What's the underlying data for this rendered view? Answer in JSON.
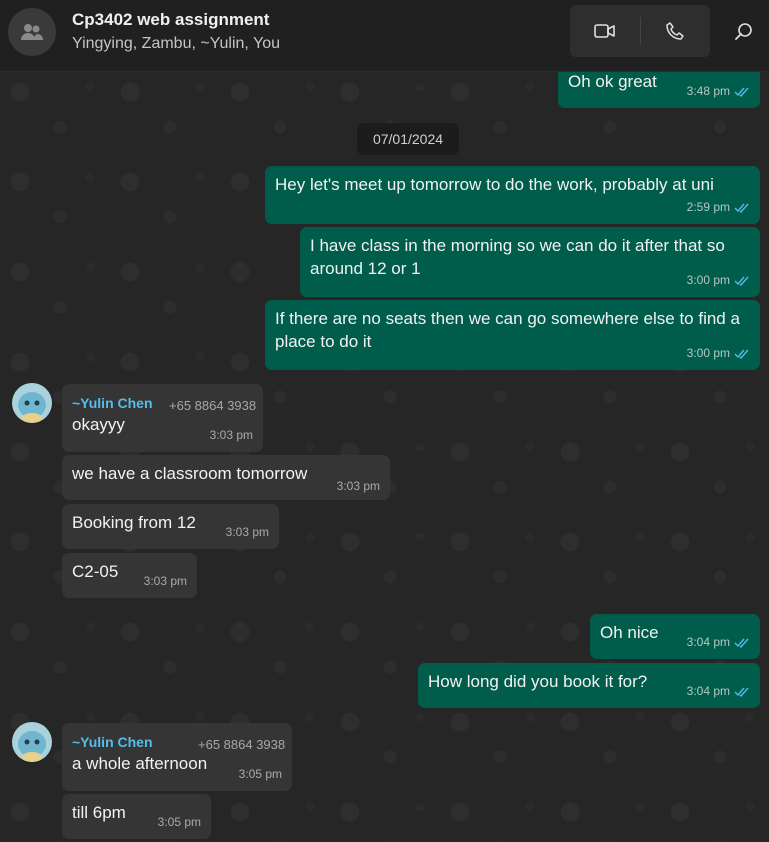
{
  "header": {
    "title": "Cp3402 web assignment",
    "members": "Yingying, Zambu, ~Yulin, You",
    "icons": {
      "avatar": "group-icon",
      "video": "video-icon",
      "call": "phone-icon",
      "search": "search-icon"
    }
  },
  "date_chip": "07/01/2024",
  "messages": [
    {
      "dir": "out",
      "text": "Oh ok great",
      "time": "3:48 pm"
    },
    {
      "dir": "out",
      "text": "Hey let's meet up tomorrow to do the work, probably at uni",
      "time": "2:59 pm"
    },
    {
      "dir": "out",
      "text": "I have class in the morning so we can do it after that so around 12 or 1",
      "time": "3:00 pm"
    },
    {
      "dir": "out",
      "text": "If there are no seats then we can go somewhere else to find a place to do it",
      "time": "3:00 pm"
    },
    {
      "dir": "in",
      "sender": "~Yulin Chen",
      "phone": "+65 8864 3938",
      "text": "okayyy",
      "time": "3:03 pm"
    },
    {
      "dir": "in",
      "text": "we have a classroom tomorrow",
      "time": "3:03 pm"
    },
    {
      "dir": "in",
      "text": "Booking from 12",
      "time": "3:03 pm"
    },
    {
      "dir": "in",
      "text": "C2-05",
      "time": "3:03 pm"
    },
    {
      "dir": "out",
      "text": "Oh nice",
      "time": "3:04 pm"
    },
    {
      "dir": "out",
      "text": "How long did you book it for?",
      "time": "3:04 pm"
    },
    {
      "dir": "in",
      "sender": "~Yulin Chen",
      "phone": "+65 8864 3938",
      "text": "a whole afternoon",
      "time": "3:05 pm"
    },
    {
      "dir": "in",
      "text": "till 6pm",
      "time": "3:05 pm"
    }
  ],
  "colors": {
    "outgoing": "#005c4b",
    "incoming": "#353535",
    "sender": "#53bdeb",
    "ticks": "#53bdeb"
  }
}
